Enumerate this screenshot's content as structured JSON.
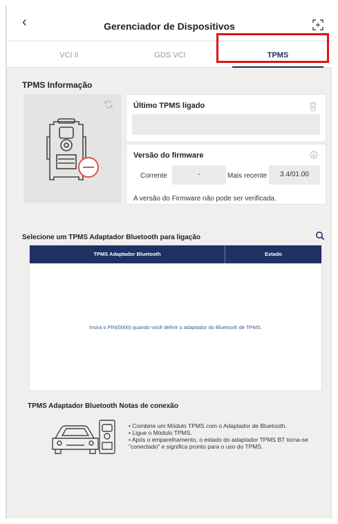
{
  "header": {
    "title": "Gerenciador de Dispositivos",
    "back_icon": "chevron-left-icon",
    "expand_icon": "fullscreen-icon"
  },
  "tabs": [
    {
      "label": "VCI II",
      "active": false
    },
    {
      "label": "GDS VCI",
      "active": false
    },
    {
      "label": "TPMS",
      "active": true
    }
  ],
  "info": {
    "title": "TPMS Informação",
    "last_connected": {
      "title": "Último TPMS ligado",
      "value": ""
    },
    "firmware": {
      "title": "Versão do firmware",
      "current_label": "Corrente",
      "current_value": "-",
      "latest_label": "Mais recente",
      "latest_value": "3.4/01.00",
      "note": "A versão do Firmware não pode ser verificada."
    }
  },
  "bluetooth": {
    "title": "Selecione um TPMS Adaptador Bluetooth para ligação",
    "columns": [
      "TPMS Adaptador Bluetooth",
      "Estado"
    ],
    "rows": [],
    "empty_message": "Insira o PIN(0000) quando você definir o adaptador do Bluetooth de TPMS."
  },
  "notes": {
    "title": "TPMS Adaptador Bluetooth Notas de conexão",
    "items": [
      "• Combine um Módulo TPMS com o Adaptador de Bluetooth.",
      "• Ligue o Módulo TPMS.",
      "• Após o emparelhamento, o estado do adaptador TPMS BT torna-se \"conectado\" e significa pronto para o uso do TPMS."
    ]
  },
  "colors": {
    "accent": "#1d3163",
    "highlight": "#e01010",
    "disconnected": "#e05050"
  }
}
